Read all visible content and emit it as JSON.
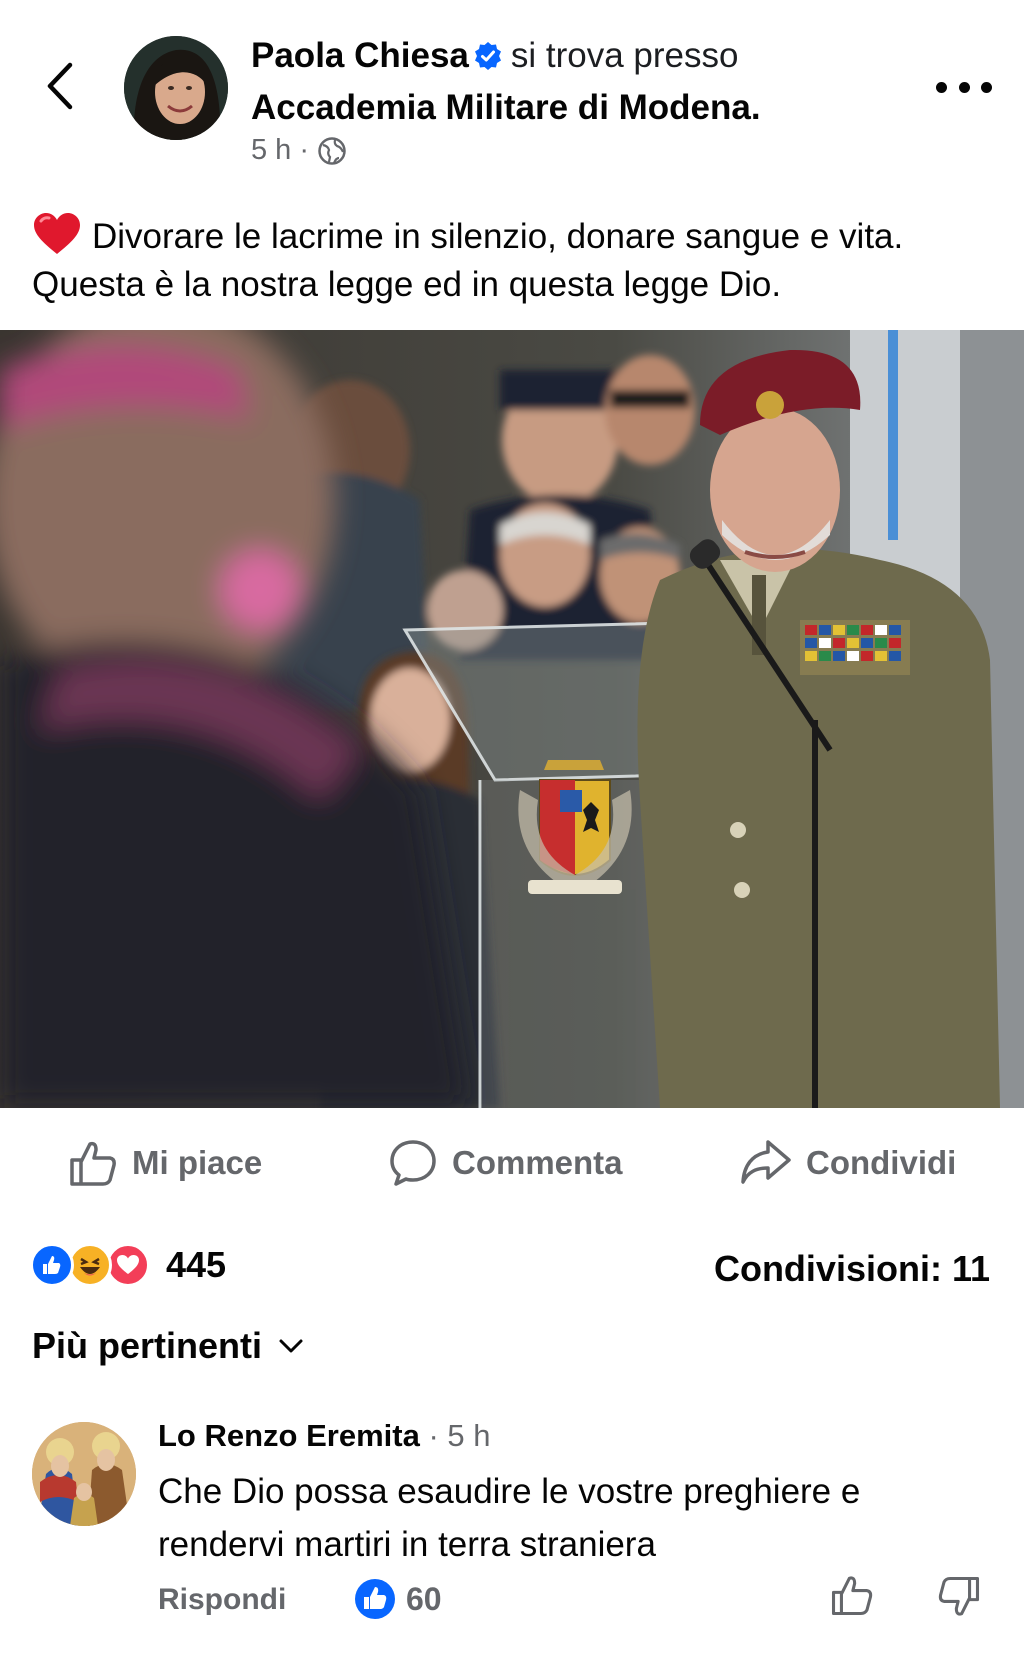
{
  "post": {
    "author": "Paola Chiesa",
    "verb": "si trova presso",
    "location": "Accademia Militare di Modena.",
    "time": "5 h",
    "meta_separator": "·",
    "caption": "Divorare le lacrime in silenzio, donare sangue e vita. Questa è la nostra legge ed in questa legge Dio.",
    "verified_icon": "verified-badge-icon",
    "privacy_icon": "globe-icon"
  },
  "actions": {
    "like": "Mi piace",
    "comment": "Commenta",
    "share": "Condividi"
  },
  "stats": {
    "reactions_count": "445",
    "reaction_types": [
      "like",
      "haha",
      "love"
    ],
    "shares": "Condivisioni: 11"
  },
  "sort": {
    "label": "Più pertinenti"
  },
  "comment": {
    "author": "Lo Renzo Eremita",
    "time": "· 5 h",
    "text": "Che Dio possa esaudire le vostre preghiere e rendervi martiri in terra straniera",
    "reply": "Rispondi",
    "likes": "60"
  },
  "colors": {
    "brand_blue": "#0866ff",
    "secondary_text": "#65676b",
    "love_red": "#f33e58",
    "haha_yellow": "#f7b125"
  }
}
